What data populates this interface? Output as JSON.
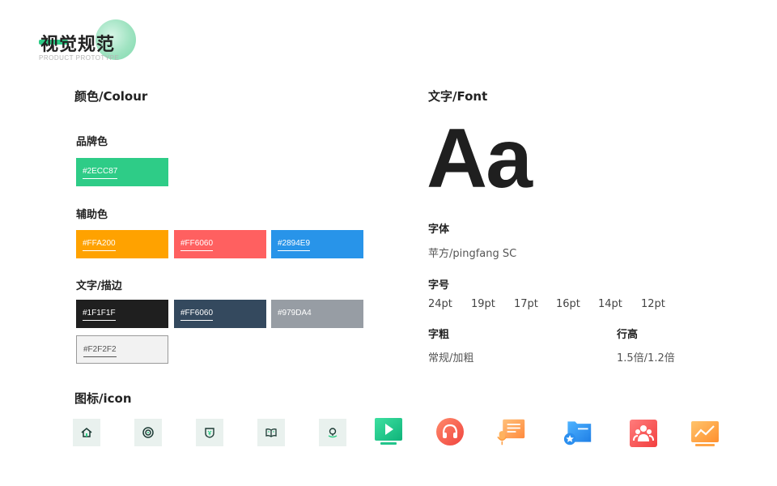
{
  "header": {
    "title": "视觉规范",
    "subtitle": "PRODUCT PROTOTYPE"
  },
  "colour": {
    "title": "颜色/Colour",
    "brand_label": "品牌色",
    "brand": [
      {
        "hex": "#2ECC87",
        "color": "#2ECC87"
      }
    ],
    "assist_label": "辅助色",
    "assist": [
      {
        "hex": "#FFA200",
        "color": "#FFA200"
      },
      {
        "hex": "#FF6060",
        "color": "#FF6060"
      },
      {
        "hex": "#2894E9",
        "color": "#2894E9"
      }
    ],
    "text_label": "文字/描边",
    "text": [
      {
        "hex": "#1F1F1F",
        "color": "#1F1F1F"
      },
      {
        "hex": "#FF6060",
        "color": "#34495E"
      },
      {
        "hex": "#979DA4",
        "color": "#979DA4"
      },
      {
        "hex": "#F2F2F2",
        "color": "#F2F2F2"
      }
    ]
  },
  "font": {
    "title": "文字/Font",
    "sample": "Aa",
    "family_label": "字体",
    "family_value": "苹方/pingfang SC",
    "size_label": "字号",
    "sizes": [
      "24pt",
      "19pt",
      "17pt",
      "16pt",
      "14pt",
      "12pt"
    ],
    "weight_label": "字粗",
    "weight_value": "常规/加粗",
    "line_label": "行高",
    "line_value": "1.5倍/1.2倍"
  },
  "icons": {
    "title": "图标/icon",
    "outline": [
      "home-icon",
      "target-icon",
      "shield-yen-icon",
      "book-icon",
      "location-icon"
    ],
    "colored": [
      "video-play-icon",
      "headphones-icon",
      "notes-microphone-icon",
      "folder-star-icon",
      "team-icon",
      "chart-trend-icon"
    ]
  }
}
